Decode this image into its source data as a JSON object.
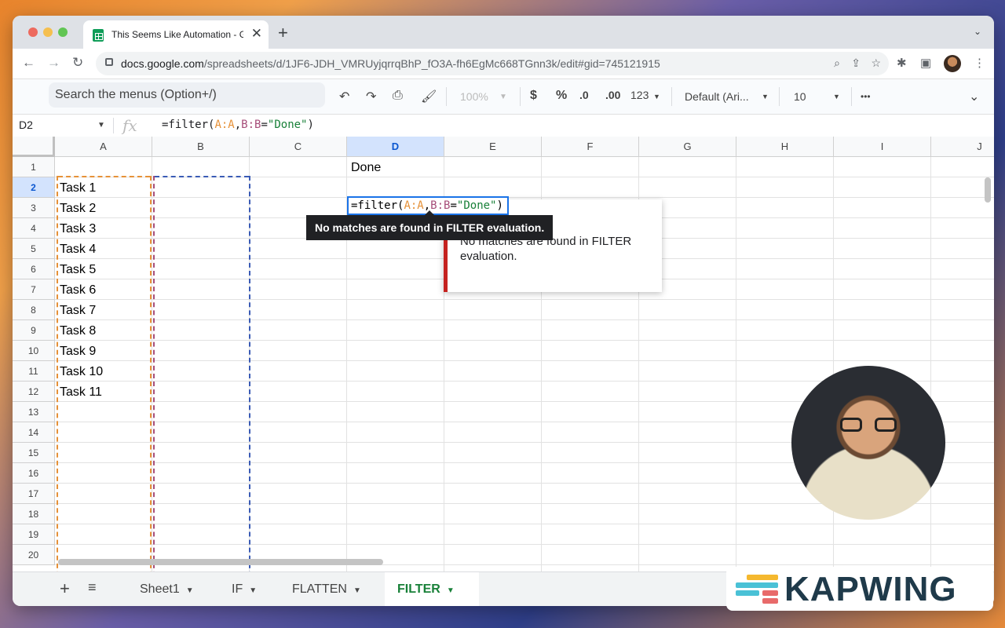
{
  "browser": {
    "tab_title": "This Seems Like Automation - G",
    "tab_close": "✕",
    "new_tab": "+",
    "url_host": "docs.google.com",
    "url_path": "/spreadsheets/d/1JF6-JDH_VMRUyjqrrqBhP_fO3A-fh6EgMc668TGnn3k/edit#gid=745121915"
  },
  "toolbar": {
    "search_menus": "Search the menus (Option+/)",
    "zoom": "100%",
    "currency": "$",
    "percent": "%",
    "dec_decrease": ".0",
    "dec_increase": ".00",
    "format_123": "123",
    "font": "Default (Ari...",
    "font_size": "10",
    "more": "•••"
  },
  "formula_bar": {
    "name_box": "D2",
    "fx": "fx",
    "formula_prefix": "=filter(",
    "formula_a": "A:A",
    "formula_comma": ",",
    "formula_b": "B:B",
    "formula_eq": "=",
    "formula_str": "\"Done\"",
    "formula_close": ")"
  },
  "grid": {
    "columns": [
      "A",
      "B",
      "C",
      "D",
      "E",
      "F",
      "G",
      "H",
      "I",
      "J"
    ],
    "selected_column": "D",
    "rows": [
      "1",
      "2",
      "3",
      "4",
      "5",
      "6",
      "7",
      "8",
      "9",
      "10",
      "11",
      "12",
      "13",
      "14",
      "15",
      "16",
      "17",
      "18",
      "19",
      "20"
    ],
    "selected_row": "2",
    "column_a": [
      "",
      "Task 1",
      "Task 2",
      "Task 3",
      "Task 4",
      "Task 5",
      "Task 6",
      "Task 7",
      "Task 8",
      "Task 9",
      "Task 10",
      "Task 11"
    ],
    "d1": "Done"
  },
  "error_tooltip": "No matches are found in FILTER evaluation.",
  "error_card": "No matches are found in FILTER evaluation.",
  "sheets": {
    "tabs": [
      "Sheet1",
      "IF",
      "FLATTEN",
      "FILTER"
    ],
    "active": "FILTER"
  },
  "watermark": "KAPWING",
  "colors": {
    "accent_blue": "#1a73e8",
    "range_a": "#e69138",
    "range_b": "#a64d79",
    "string_green": "#188038",
    "error_red": "#c5221f"
  }
}
